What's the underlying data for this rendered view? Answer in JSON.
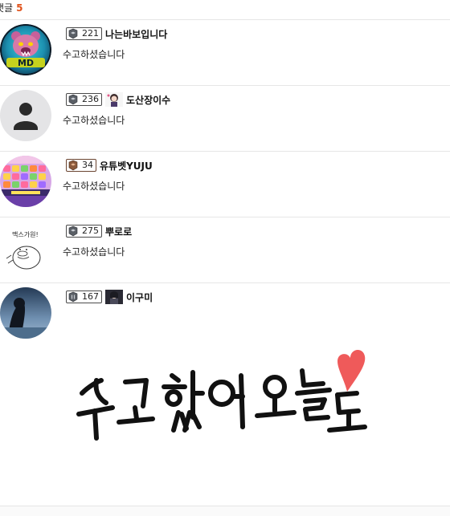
{
  "header": {
    "label": "댓글",
    "count": "5"
  },
  "comments": [
    {
      "level": "221",
      "nickname": "나는바보입니다",
      "text": "수고하셨습니다",
      "avatar_icon": "bear-logo-avatar",
      "badge_tier": "silver"
    },
    {
      "level": "236",
      "nickname": "도산장이수",
      "text": "수고하셨습니다",
      "avatar_icon": "default-person-avatar",
      "badge_tier": "silver"
    },
    {
      "level": "34",
      "nickname": "유튜벳YUJU",
      "text": "수고하셨습니다",
      "avatar_icon": "slot-game-avatar",
      "badge_tier": "bronze"
    },
    {
      "level": "275",
      "nickname": "뿌로로",
      "text": "수고하셨습니다",
      "avatar_icon": "duck-cartoon-avatar",
      "avatar_caption": "맥스가원!",
      "badge_tier": "silver"
    },
    {
      "level": "167",
      "nickname": "이구미",
      "text": "",
      "avatar_icon": "photo-avatar",
      "badge_tier": "silver"
    }
  ],
  "sticker": {
    "text": "수고했어 오늘도",
    "heart_color": "#ef5a5a"
  }
}
